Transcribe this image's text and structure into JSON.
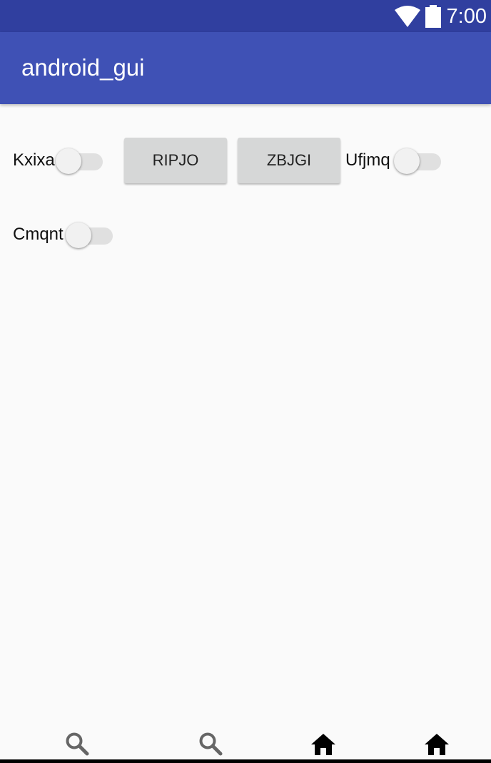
{
  "status_bar": {
    "time": "7:00",
    "icons": [
      "wifi-icon",
      "battery-icon"
    ]
  },
  "app_bar": {
    "title": "android_gui"
  },
  "content": {
    "switches": [
      {
        "label": "Kxixa",
        "checked": false
      },
      {
        "label": "Ufjmq",
        "checked": false
      },
      {
        "label": "Cmqnt",
        "checked": false
      }
    ],
    "buttons": [
      {
        "label": "RIPJO"
      },
      {
        "label": "ZBJGI"
      }
    ]
  },
  "bottom_nav": {
    "icons": [
      "search-icon",
      "search-icon",
      "home-icon",
      "home-icon"
    ]
  },
  "colors": {
    "primary": "#3f51b5",
    "primary_dark": "#303f9f",
    "background": "#fafafa",
    "button": "#d6d7d7"
  }
}
